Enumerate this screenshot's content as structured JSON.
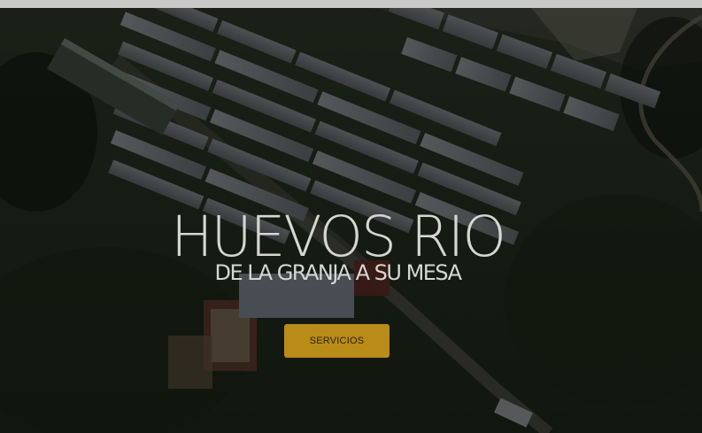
{
  "hero": {
    "title": "HUEVOS RIO",
    "subtitle": "DE LA GRANJA A SU MESA",
    "cta_label": "SERVICIOS"
  },
  "colors": {
    "accent": "#b98b18",
    "text": "#d6d6d4",
    "top_strip": "#c9c9c7"
  }
}
